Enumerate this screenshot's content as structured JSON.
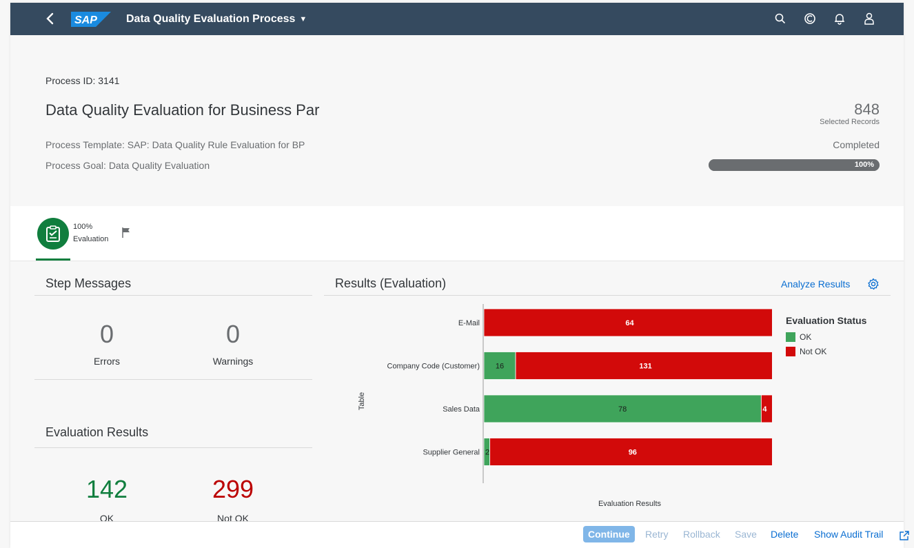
{
  "shell": {
    "title": "Data Quality Evaluation Process",
    "logo_text": "SAP",
    "icons": [
      "back-icon",
      "search-icon",
      "copilot-icon",
      "bell-icon",
      "user-icon"
    ]
  },
  "header": {
    "process_id": "Process ID: 3141",
    "title": "Data Quality Evaluation for Business Par",
    "template": "Process Template: SAP: Data Quality Rule Evaluation for BP",
    "goal": "Process Goal: Data Quality Evaluation",
    "selected_count": "848",
    "selected_label": "Selected Records",
    "status": "Completed",
    "progress_text": "100%",
    "progress_value": 1.0
  },
  "step": {
    "percent": "100%",
    "name": "Evaluation"
  },
  "step_messages": {
    "title": "Step Messages",
    "errors_value": "0",
    "errors_label": "Errors",
    "warnings_value": "0",
    "warnings_label": "Warnings"
  },
  "evaluation_results": {
    "title": "Evaluation Results",
    "ok_value": "142",
    "ok_label": "OK",
    "notok_value": "299",
    "notok_label": "Not OK"
  },
  "results_panel": {
    "title": "Results (Evaluation)",
    "analyze_label": "Analyze Results",
    "legend_title": "Evaluation Status"
  },
  "chart_data": {
    "type": "bar",
    "orientation": "horizontal",
    "stacked": true,
    "normalized": true,
    "categories": [
      "E-Mail",
      "Company Code (Customer)",
      "Sales Data",
      "Supplier General"
    ],
    "series": [
      {
        "name": "OK",
        "values": [
          0,
          16,
          78,
          2
        ],
        "color": "#3fa45b"
      },
      {
        "name": "Not OK",
        "values": [
          64,
          131,
          4,
          96
        ],
        "color": "#d20a0a"
      }
    ],
    "xlabel": "Evaluation Results",
    "ylabel": "Table",
    "legend": "right"
  },
  "footer": {
    "continue": "Continue",
    "retry": "Retry",
    "rollback": "Rollback",
    "save": "Save",
    "delete": "Delete",
    "audit": "Show Audit Trail"
  },
  "colors": {
    "shell": "#354a5f",
    "ok": "#107e3e",
    "notok": "#bb0000",
    "link": "#0a6ed1"
  }
}
